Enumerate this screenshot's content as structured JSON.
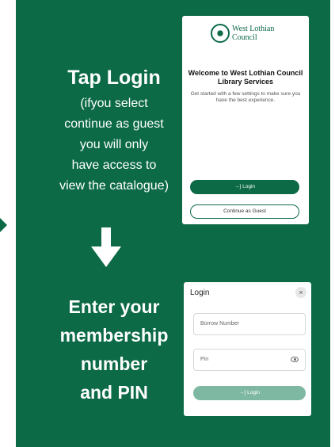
{
  "colors": {
    "brand_green": "#0c6a47",
    "disabled_green": "#7fb8a2"
  },
  "step1": {
    "title": "Tap Login",
    "lines": [
      "(ifyou select",
      "continue as guest",
      "you will only",
      "have access to",
      "view the catalogue)"
    ]
  },
  "step2": {
    "lines": [
      "Enter your",
      "membership",
      "number",
      "and PIN"
    ]
  },
  "welcome_screen": {
    "logo_text_line1": "West Lothian",
    "logo_text_line2": "Council",
    "title": "Welcome to West Lothian Council Library Services",
    "body": "Get started with a few settings to make sure you have the best experience.",
    "login_button": "Login",
    "guest_button": "Continue as Guest"
  },
  "login_screen": {
    "title": "Login",
    "close_label": "×",
    "borrow_placeholder": "Borrow Number",
    "pin_placeholder": "Pin",
    "login_button": "Login"
  }
}
